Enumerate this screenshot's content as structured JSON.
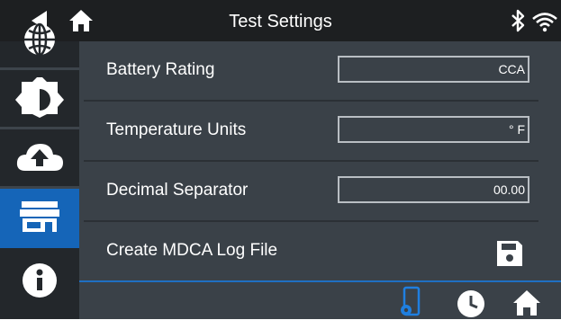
{
  "header": {
    "title": "Test Settings",
    "back_icon": "back-arrow-icon",
    "home_icon": "home-icon",
    "bluetooth_icon": "bluetooth-icon",
    "wifi_icon": "wifi-icon"
  },
  "sidebar": {
    "items": [
      {
        "icon": "globe-icon"
      },
      {
        "icon": "brightness-icon"
      },
      {
        "icon": "cloud-upload-icon"
      },
      {
        "icon": "store-icon",
        "active": true
      },
      {
        "icon": "info-icon"
      }
    ]
  },
  "settings": {
    "battery_rating": {
      "label": "Battery Rating",
      "value": "CCA"
    },
    "temperature_units": {
      "label": "Temperature Units",
      "value": "° F"
    },
    "decimal_separator": {
      "label": "Decimal Separator",
      "value": "00.00"
    },
    "create_log": {
      "label": "Create MDCA Log File",
      "icon": "save-icon"
    }
  },
  "footer": {
    "icons": [
      "phone-settings-icon",
      "clock-icon",
      "home-icon"
    ]
  },
  "colors": {
    "accent": "#1565b8",
    "topbar": "#1d1f21",
    "sidebar": "#23272b",
    "content_bg": "#3a4148",
    "text": "#ffffff"
  }
}
